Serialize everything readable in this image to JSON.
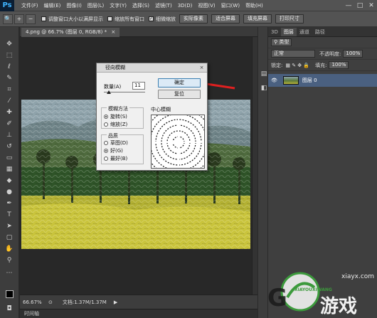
{
  "menubar": {
    "logo": "Ps",
    "items": [
      "文件(F)",
      "编辑(E)",
      "图像(I)",
      "图层(L)",
      "文字(Y)",
      "选择(S)",
      "滤镜(T)",
      "3D(D)",
      "视图(V)",
      "窗口(W)",
      "帮助(H)"
    ],
    "minimize": "—",
    "maximize": "□",
    "close": "✕"
  },
  "options": {
    "zoom_icon": "🔍",
    "zoom_in": "+",
    "zoom_out": "−",
    "resize_windows": "调整窗口大小以满屏显示",
    "zoom_all": "缩放所有窗口",
    "scrubby_zoom": "细微缩放",
    "buttons": [
      "实际像素",
      "适合屏幕",
      "填充屏幕",
      "打印尺寸"
    ]
  },
  "document": {
    "tab": "4.png @ 66.7% (图层 0, RGB/8) *",
    "tab_close": "×",
    "zoom": "66.67%",
    "doc_info": "文档:1.37M/1.37M",
    "timeline": "时间轴"
  },
  "layers": {
    "tabs": [
      "3D",
      "图层",
      "通道",
      "路径"
    ],
    "filter_kind": "类型",
    "blend_mode": "正常",
    "opacity_label": "不透明度:",
    "opacity": "100%",
    "lock_label": "锁定:",
    "fill_label": "填充:",
    "fill": "100%",
    "layer_name": "图层 0"
  },
  "dialog": {
    "title": "径向模糊",
    "close": "×",
    "ok": "确定",
    "reset": "复位",
    "amount_label": "数量(A)",
    "amount": "11",
    "blur_method_label": "模糊方法",
    "methods": [
      "旋转(S)",
      "缩放(Z)"
    ],
    "selected_method": "旋转(S)",
    "quality_label": "品质",
    "qualities": [
      "草图(D)",
      "好(G)",
      "最好(B)"
    ],
    "selected_quality": "好(G)",
    "center_label": "中心模糊"
  },
  "watermark": {
    "big": "游戏",
    "site": "xiayx.com",
    "small": "XIAYOUXIWANG"
  },
  "colors": {
    "annotation_arrow": "#e02020",
    "ok_border": "#3c7fb1",
    "layer_selected": "#4a6080"
  }
}
